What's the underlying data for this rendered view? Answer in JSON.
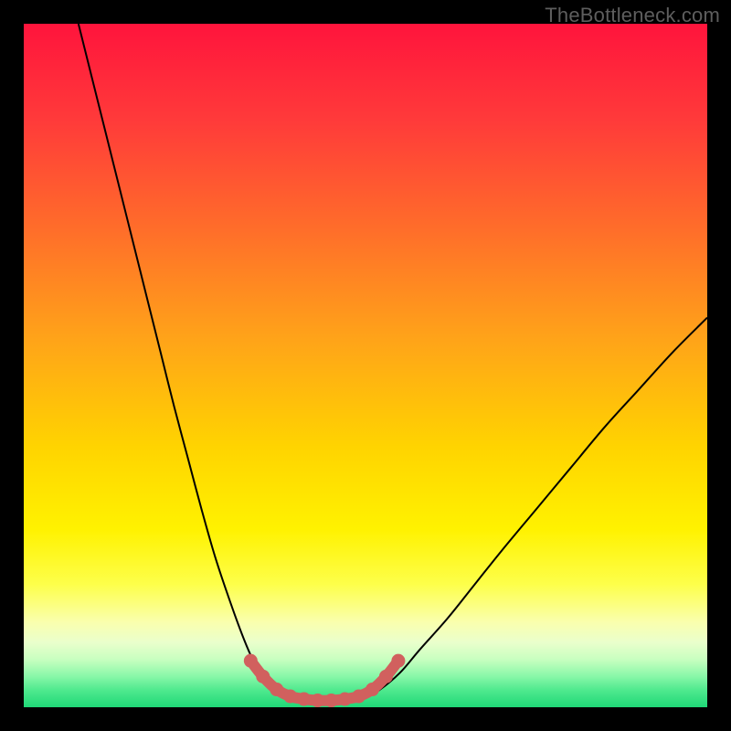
{
  "watermark": "TheBottleneck.com",
  "colors": {
    "black": "#000000",
    "curve": "#000000",
    "marker": "#d1605e",
    "gradient_stops": [
      {
        "offset": 0.0,
        "color": "#ff143c"
      },
      {
        "offset": 0.14,
        "color": "#ff3a3a"
      },
      {
        "offset": 0.3,
        "color": "#ff6d2a"
      },
      {
        "offset": 0.46,
        "color": "#ffa319"
      },
      {
        "offset": 0.62,
        "color": "#ffd400"
      },
      {
        "offset": 0.74,
        "color": "#fff200"
      },
      {
        "offset": 0.82,
        "color": "#fdff4a"
      },
      {
        "offset": 0.875,
        "color": "#faffad"
      },
      {
        "offset": 0.905,
        "color": "#eaffcc"
      },
      {
        "offset": 0.93,
        "color": "#c8ffc0"
      },
      {
        "offset": 0.955,
        "color": "#88f7a8"
      },
      {
        "offset": 0.975,
        "color": "#4fe98e"
      },
      {
        "offset": 1.0,
        "color": "#1fd877"
      }
    ]
  },
  "chart_data": {
    "type": "line",
    "title": "",
    "xlabel": "",
    "ylabel": "",
    "xlim": [
      0,
      100
    ],
    "ylim": [
      0,
      100
    ],
    "grid": false,
    "legend": false,
    "series": [
      {
        "name": "left-curve",
        "x": [
          8,
          10,
          12,
          14,
          16,
          18,
          20,
          22,
          24,
          26,
          28,
          30,
          32,
          33.5,
          35,
          36.5,
          38
        ],
        "y": [
          100,
          92,
          84,
          76,
          68,
          60,
          52,
          44,
          36.5,
          29,
          22,
          16,
          10.5,
          7,
          4.5,
          2.5,
          1.5
        ]
      },
      {
        "name": "trough",
        "x": [
          38,
          40,
          42,
          44,
          46,
          48,
          50
        ],
        "y": [
          1.5,
          1.1,
          1.0,
          1.0,
          1.0,
          1.1,
          1.5
        ]
      },
      {
        "name": "right-curve",
        "x": [
          50,
          52,
          55,
          58,
          62,
          66,
          70,
          75,
          80,
          85,
          90,
          95,
          100
        ],
        "y": [
          1.5,
          2.5,
          5,
          8.5,
          13,
          18,
          23,
          29,
          35,
          41,
          46.5,
          52,
          57
        ]
      },
      {
        "name": "trough-markers",
        "x": [
          33.2,
          35.0,
          37.0,
          39.0,
          41.0,
          43.0,
          45.0,
          47.0,
          49.0,
          51.0,
          53.0,
          54.8
        ],
        "y": [
          6.8,
          4.5,
          2.6,
          1.6,
          1.2,
          1.0,
          1.0,
          1.2,
          1.6,
          2.6,
          4.5,
          6.8
        ]
      }
    ]
  }
}
